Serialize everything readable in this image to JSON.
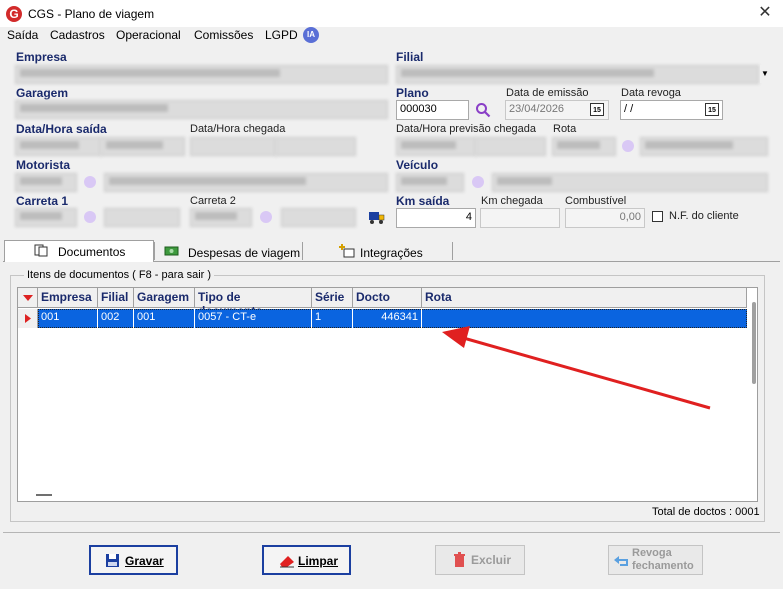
{
  "window": {
    "title": "CGS - Plano de viagem",
    "logo": "G"
  },
  "menu": [
    {
      "label": "Saída"
    },
    {
      "label": "Cadastros"
    },
    {
      "label": "Operacional"
    },
    {
      "label": "Comissões"
    },
    {
      "label": "LGPD"
    }
  ],
  "ia_badge": "IA",
  "form": {
    "empresa_label": "Empresa",
    "filial_label": "Filial",
    "garagem_label": "Garagem",
    "plano_label": "Plano",
    "plano_value": "000030",
    "data_emissao_label": "Data de emissão",
    "data_emissao_value": "23/04/2026",
    "data_revoga_label": "Data revoga",
    "data_revoga_value": " / /",
    "data_hora_saida_label": "Data/Hora saída",
    "data_hora_chegada_label": "Data/Hora chegada",
    "previsao_chegada_label": "Data/Hora previsão chegada",
    "rota_label": "Rota",
    "motorista_label": "Motorista",
    "veiculo_label": "Veículo",
    "carreta1_label": "Carreta 1",
    "carreta2_label": "Carreta 2",
    "km_saida_label": "Km saída",
    "km_saida_value": "4",
    "km_chegada_label": "Km chegada",
    "combustivel_label": "Combustível",
    "combustivel_value": "0,00",
    "nf_cliente_label": "N.F. do cliente",
    "calendar_icon_text": "15"
  },
  "tabs": [
    {
      "label": "Documentos",
      "active": true
    },
    {
      "label": "Despesas de viagem",
      "active": false
    },
    {
      "label": "Integrações",
      "active": false
    }
  ],
  "documents": {
    "group_title": "Itens de documentos ( F8 - para sair )",
    "columns": [
      "Empresa",
      "Filial",
      "Garagem",
      "Tipo de documento",
      "Série",
      "Docto",
      "Rota"
    ],
    "rows": [
      {
        "empresa": "001",
        "filial": "002",
        "garagem": "001",
        "tipo": "0057 - CT-e",
        "serie": "1",
        "docto": "446341",
        "rota": ""
      }
    ],
    "total_label": "Total de doctos : 0001"
  },
  "buttons": {
    "gravar": "Gravar",
    "limpar": "Limpar",
    "excluir": "Excluir",
    "revoga_line1": "Revoga",
    "revoga_line2": "fechamento"
  },
  "colors": {
    "selection": "#0a64e0",
    "annotation_arrow": "#e02020",
    "label_blue": "#1a2a6c"
  }
}
